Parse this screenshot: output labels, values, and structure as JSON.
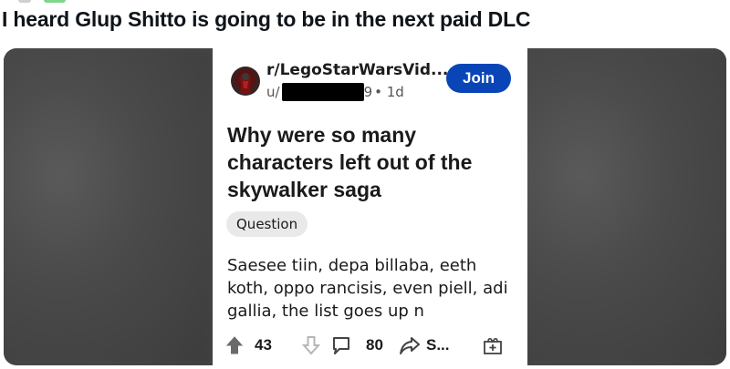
{
  "tweet": {
    "caption": "I heard Glup Shitto is going to be in the next paid DLC"
  },
  "post": {
    "subreddit": "r/LegoStarWarsVid...",
    "user_prefix": "u/",
    "user_suffix": "9",
    "age": "• 1d",
    "join_label": "Join",
    "title": "Why were so many characters left out of the skywalker saga",
    "flair": "Question",
    "body": "Saesee tiin, depa billaba, eeth koth, oppo rancisis, even piell, adi gallia, the list goes up n",
    "upvotes": "43",
    "comments": "80",
    "share_label": "S..."
  },
  "icons": {
    "upvote": "upvote-icon",
    "downvote": "downvote-icon",
    "comment": "comment-icon",
    "share": "share-icon",
    "award": "award-icon"
  },
  "colors": {
    "join_bg": "#0a45b8",
    "frame_bg": "#484848"
  }
}
